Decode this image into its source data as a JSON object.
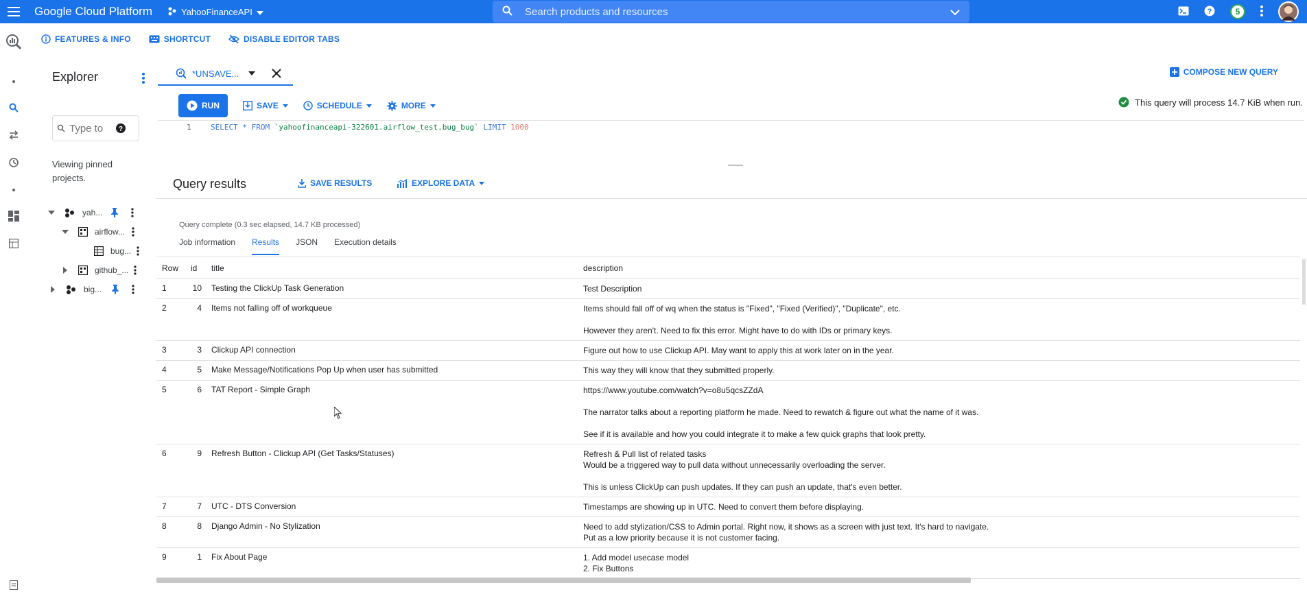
{
  "topbar": {
    "brand": "Google Cloud Platform",
    "project": "YahooFinanceAPI",
    "search_placeholder": "Search products and resources",
    "notification_count": "5"
  },
  "secbar": {
    "features": "FEATURES & INFO",
    "shortcut": "SHORTCUT",
    "disable_tabs": "DISABLE EDITOR TABS"
  },
  "explorer": {
    "title": "Explorer",
    "search_placeholder": "Type to",
    "viewing": "Viewing pinned projects.",
    "tree": [
      {
        "label": "yah..."
      },
      {
        "label": "airflow..."
      },
      {
        "label": "bug..."
      },
      {
        "label": "github_..."
      },
      {
        "label": "big..."
      }
    ]
  },
  "editor": {
    "tab_label": "*UNSAVE...",
    "compose": "COMPOSE NEW QUERY",
    "run": "RUN",
    "save": "SAVE",
    "schedule": "SCHEDULE",
    "more": "MORE",
    "validator": "This query will process 14.7 KiB when run.",
    "line_number": "1",
    "code_kw1": "SELECT * FROM ",
    "code_table": "`yahoofinanceapi-322601.airflow_test.bug_bug`",
    "code_kw2": " LIMIT ",
    "code_num": "1000"
  },
  "results": {
    "title": "Query results",
    "save_results": "SAVE RESULTS",
    "explore_data": "EXPLORE DATA",
    "status": "Query complete (0.3 sec elapsed, 14.7 KB processed)",
    "tabs": [
      "Job information",
      "Results",
      "JSON",
      "Execution details"
    ],
    "columns": [
      "Row",
      "id",
      "title",
      "description"
    ],
    "rows": [
      {
        "row": "1",
        "id": "10",
        "title": "Testing the ClickUp Task Generation",
        "desc": [
          "Test Description"
        ]
      },
      {
        "row": "2",
        "id": "4",
        "title": "Items not falling off of workqueue",
        "desc": [
          "Items should fall off of wq when the status is \"Fixed\", \"Fixed (Verified)\", \"Duplicate\", etc.",
          "",
          "However they aren't. Need to fix this error. Might have to do with IDs or primary keys."
        ]
      },
      {
        "row": "3",
        "id": "3",
        "title": "Clickup API connection",
        "desc": [
          "Figure out how to use Clickup API. May want to apply this at work later on in the year."
        ]
      },
      {
        "row": "4",
        "id": "5",
        "title": "Make Message/Notifications Pop Up when user has submitted",
        "desc": [
          "This way they will know that they submitted properly."
        ]
      },
      {
        "row": "5",
        "id": "6",
        "title": "TAT Report - Simple Graph",
        "desc": [
          "https://www.youtube.com/watch?v=o8u5qcsZZdA",
          "",
          "The narrator talks about a reporting platform he made. Need to rewatch & figure out what the name of it was.",
          "",
          "See if it is available and how you could integrate it to make a few quick graphs that look pretty."
        ]
      },
      {
        "row": "6",
        "id": "9",
        "title": "Refresh Button - Clickup API (Get Tasks/Statuses)",
        "desc": [
          "Refresh & Pull list of related tasks",
          "Would be a triggered way to pull data without unnecessarily overloading the server.",
          "",
          "This is unless ClickUp can push updates. If they can push an update, that's even better."
        ]
      },
      {
        "row": "7",
        "id": "7",
        "title": "UTC - DTS Conversion",
        "desc": [
          "Timestamps are showing up in UTC. Need to convert them before displaying."
        ]
      },
      {
        "row": "8",
        "id": "8",
        "title": "Django Admin - No Stylization",
        "desc": [
          "Need to add stylization/CSS to Admin portal. Right now, it shows as a screen with just text. It's hard to navigate.",
          "Put as a low priority because it is not customer facing."
        ]
      },
      {
        "row": "9",
        "id": "1",
        "title": "Fix About Page",
        "desc": [
          "1. Add model usecase model",
          "2. Fix Buttons"
        ]
      }
    ]
  },
  "colors": {
    "accent": "#1a73e8",
    "topbar": "#1a73e8",
    "success": "#1e8e3e"
  }
}
